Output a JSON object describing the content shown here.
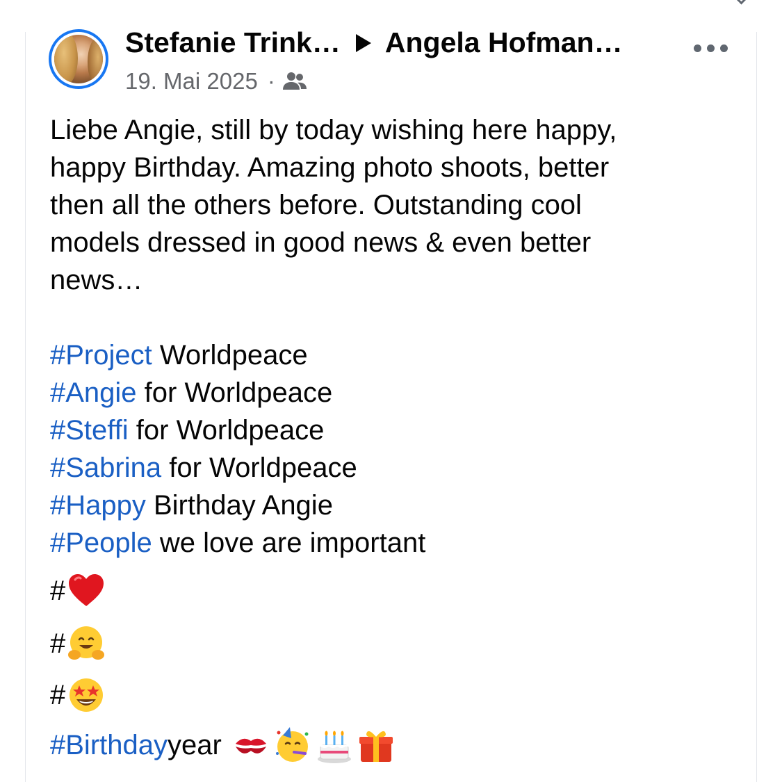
{
  "post": {
    "author": "Stefanie Trink…",
    "recipient": "Angela Hofman…",
    "date": "19. Mai 2025",
    "separator": "·",
    "audience_icon": "friends-icon",
    "more_icon": "more-options-icon",
    "avatar": "author-avatar-photo"
  },
  "body": {
    "paragraph_lines": [
      "Liebe Angie, still by today wishing here happy,",
      "happy Birthday. Amazing photo shoots, better",
      "then all the others before. Outstanding cool",
      "models dressed in good news & even better",
      "news…"
    ],
    "hashtag_lines": [
      {
        "tag": "#Project",
        "rest": " Worldpeace"
      },
      {
        "tag": "#Angie",
        "rest": " for Worldpeace"
      },
      {
        "tag": "#Steffi",
        "rest": " for Worldpeace"
      },
      {
        "tag": "#Sabrina",
        "rest": " for Worldpeace"
      },
      {
        "tag": "#Happy",
        "rest": " Birthday Angie"
      },
      {
        "tag": "#People",
        "rest": " we love are important"
      }
    ],
    "emoji_lines": [
      {
        "hash": "#",
        "emoji": "red-heart-emoji"
      },
      {
        "hash": "#",
        "emoji": "hugging-face-emoji"
      },
      {
        "hash": "#",
        "emoji": "star-struck-emoji"
      }
    ],
    "last_line": {
      "tag": "#Birthday",
      "rest": " year",
      "emojis": [
        "kiss-mark-emoji",
        "partying-face-emoji",
        "birthday-cake-emoji",
        "wrapped-gift-emoji"
      ]
    }
  },
  "colors": {
    "hashtag": "#1a5fc4",
    "text": "#050505",
    "meta": "#65676b",
    "avatar_ring": "#1877f2"
  }
}
